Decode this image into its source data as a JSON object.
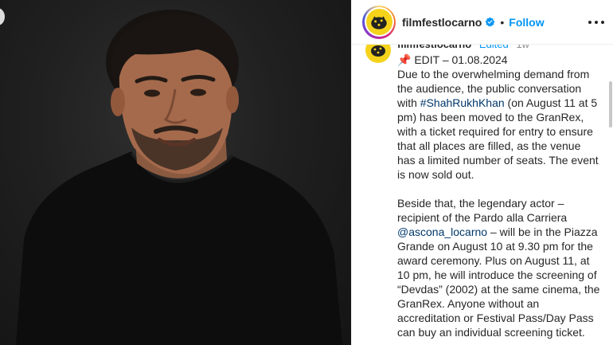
{
  "post": {
    "username": "filmfestlocarno",
    "separator": "•",
    "follow_label": "Follow"
  },
  "caption": {
    "username": "filmfestlocarno",
    "edited_label": "Edited",
    "time": "1w",
    "edit_line": "📌 EDIT – 01.08.2024",
    "para1_a": "Due to the overwhelming demand from the audience, the public conversation with ",
    "hashtag": "#ShahRukhKhan",
    "para1_b": " (on August 11 at 5 pm) has been moved to the GranRex, with a ticket required for entry to ensure that all places are filled, as the venue has a limited number of seats. The event is now sold out.",
    "para2_a": "Beside that, the legendary actor – recipient of the Pardo alla Carriera ",
    "mention": "@ascona_locarno",
    "para2_b": " – will be in the Piazza Grande on August 10 at 9.30 pm for the award ceremony. Plus on August 11, at 10 pm, he will introduce the screening of “Devdas” (2002) at the same cinema, the GranRex. Anyone without an accreditation or Festival Pass/Day Pass can buy an individual screening ticket."
  },
  "colors": {
    "accent": "#0095f6",
    "link": "#00376b",
    "logo_yellow": "#f5d31a",
    "photo_bg": "#1c1c1c"
  },
  "icons": {
    "verified": "verified-badge-icon",
    "more": "more-options-icon",
    "logo": "leopard-logo-icon"
  }
}
